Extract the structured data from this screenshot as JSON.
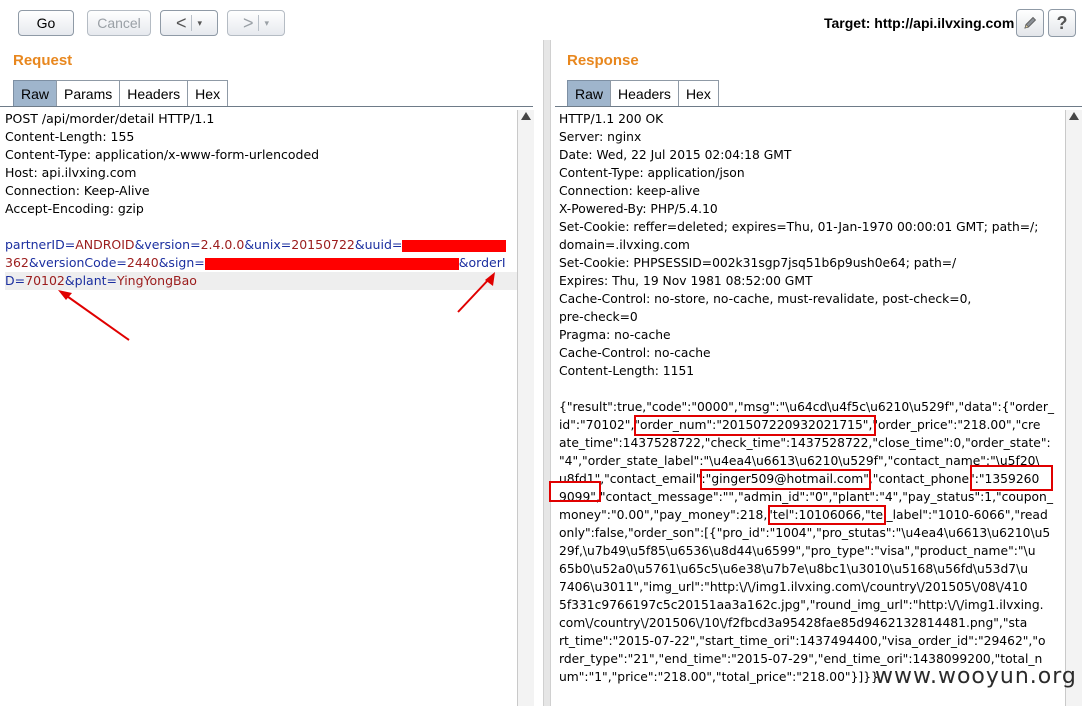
{
  "toolbar": {
    "go_label": "Go",
    "cancel_label": "Cancel",
    "back_arrow": "<",
    "forward_arrow": ">",
    "caret": "▾",
    "target_label": "Target: http://api.ilvxing.com"
  },
  "request": {
    "title": "Request",
    "tabs": [
      "Raw",
      "Params",
      "Headers",
      "Hex"
    ],
    "headers": [
      "POST /api/morder/detail HTTP/1.1",
      "Content-Length: 155",
      "Content-Type: application/x-www-form-urlencoded",
      "Host: api.ilvxing.com",
      "Connection: Keep-Alive",
      "Accept-Encoding: gzip"
    ],
    "body": {
      "partnerID_key": "partnerID",
      "partnerID_val": "ANDROID",
      "version_key": "&version",
      "version_val": "2.4.0.0",
      "unix_key": "&unix",
      "unix_val": "20150722",
      "uuid_key": "&uuid",
      "uuid_tail": "362",
      "versionCode_key": "&versionCode",
      "versionCode_val": "2440",
      "sign_key": "&sign",
      "orderI_key": "&orderI",
      "orderD_key": "D",
      "orderID_val": "70102",
      "plant_key": "&plant",
      "plant_val": "YingYongBao",
      "eq": "="
    }
  },
  "response": {
    "title": "Response",
    "tabs": [
      "Raw",
      "Headers",
      "Hex"
    ],
    "lines": [
      "HTTP/1.1 200 OK",
      "Server: nginx",
      "Date: Wed, 22 Jul 2015 02:04:18 GMT",
      "Content-Type: application/json",
      "Connection: keep-alive",
      "X-Powered-By: PHP/5.4.10",
      "Set-Cookie: reffer=deleted; expires=Thu, 01-Jan-1970 00:00:01 GMT; path=/;",
      "domain=.ilvxing.com",
      "Set-Cookie: PHPSESSID=002k31sgp7jsq51b6p9ush0e64; path=/",
      "Expires: Thu, 19 Nov 1981 08:52:00 GMT",
      "Cache-Control: no-store, no-cache, must-revalidate, post-check=0,",
      "pre-check=0",
      "Pragma: no-cache",
      "Cache-Control: no-cache",
      "Content-Length: 1151",
      "",
      "{\"result\":true,\"code\":\"0000\",\"msg\":\"\\u64cd\\u4f5c\\u6210\\u529f\",\"data\":{\"order_",
      "id\":\"70102\",\"order_num\":\"201507220932021715\",\"order_price\":\"218.00\",\"cre",
      "ate_time\":1437528722,\"check_time\":1437528722,\"close_time\":0,\"order_state\":",
      "\"4\",\"order_state_label\":\"\\u4ea4\\u6613\\u6210\\u529f\",\"contact_name\":\"\\u5f20\\",
      "u8fd1\",\"contact_email\":\"ginger509@hotmail.com\",\"contact_phone\":\"1359260",
      "9099\",\"contact_message\":\"\",\"admin_id\":\"0\",\"plant\":\"4\",\"pay_status\":1,\"coupon_",
      "money\":\"0.00\",\"pay_money\":218,\"tel\":10106066,\"tel_label\":\"1010-6066\",\"read",
      "only\":false,\"order_son\":[{\"pro_id\":\"1004\",\"pro_stutas\":\"\\u4ea4\\u6613\\u6210\\u5",
      "29f,\\u7b49\\u5f85\\u6536\\u8d44\\u6599\",\"pro_type\":\"visa\",\"product_name\":\"\\u",
      "65b0\\u52a0\\u5761\\u65c5\\u6e38\\u7b7e\\u8bc1\\u3010\\u5168\\u56fd\\u53d7\\u",
      "7406\\u3011\",\"img_url\":\"http:\\/\\/img1.ilvxing.com\\/country\\/201505\\/08\\/410",
      "5f331c9766197c5c20151aa3a162c.jpg\",\"round_img_url\":\"http:\\/\\/img1.ilvxing.",
      "com\\/country\\/201506\\/10\\/f2fbcd3a95428fae85d9462132814481.png\",\"sta",
      "rt_time\":\"2015-07-22\",\"start_time_ori\":1437494400,\"visa_order_id\":\"29462\",\"o",
      "rder_type\":\"21\",\"end_time\":\"2015-07-29\",\"end_time_ori\":1438099200,\"total_n",
      "um\":\"1\",\"price\":\"218.00\",\"total_price\":\"218.00\"}]}}"
    ]
  },
  "watermark": "www.wooyun.org",
  "colors": {
    "accent_title": "#e8871e",
    "active_tab": "#9fb5cc",
    "param_key": "#1b2fa0",
    "param_value": "#9b1c1c",
    "annotation_red": "#e00000"
  },
  "icons": {
    "pencil": "pencil-icon",
    "help": "help-icon"
  }
}
